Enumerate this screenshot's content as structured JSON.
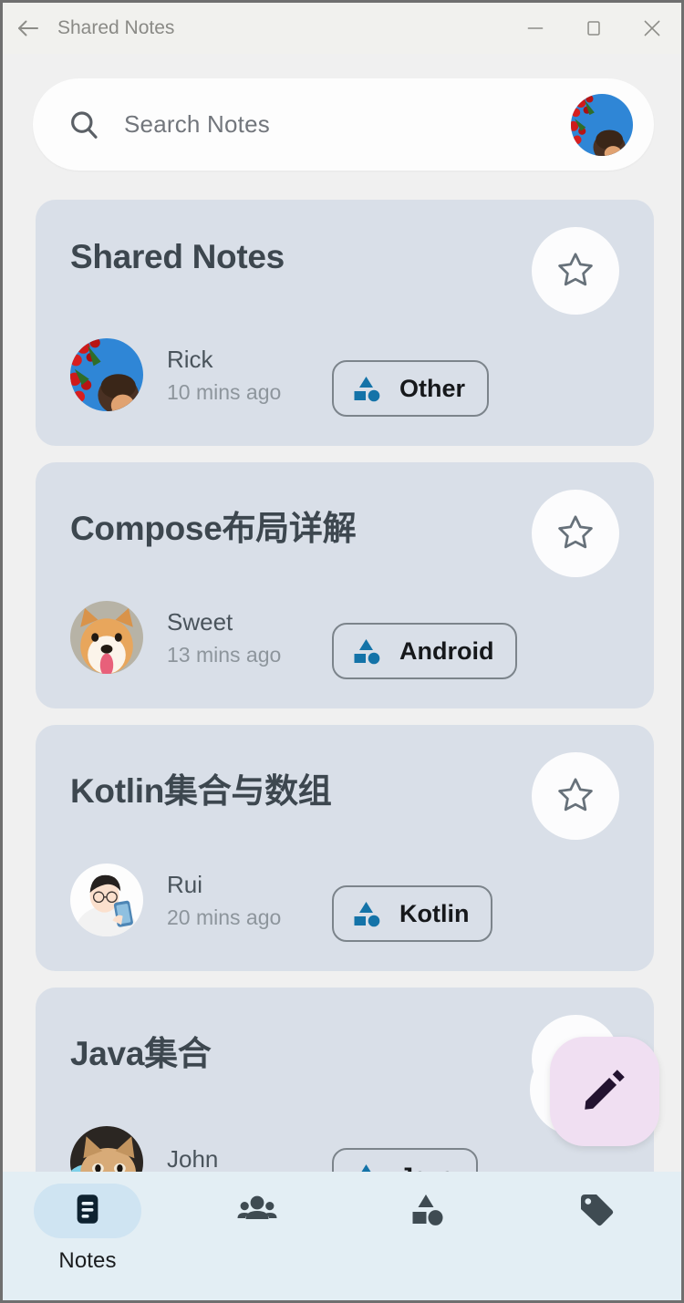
{
  "window": {
    "title": "Shared Notes",
    "back_icon": "arrow-left-icon",
    "minimize_label": "—",
    "maximize_label": "□",
    "close_label": "✕"
  },
  "search": {
    "placeholder": "Search Notes",
    "icon": "search-icon",
    "avatar_name": "user-avatar"
  },
  "colors": {
    "page_background": "#f0f0f0",
    "titlebar_background": "#f1f1ee",
    "card_background": "#d9dfe8",
    "card_title": "#3d474f",
    "chip_icon_blue": "#1473a8",
    "bottomnav_background": "#e3eef4",
    "nav_active_pill": "#cfe4f2",
    "fab_background": "#f0dff2",
    "fab_icon": "#231330",
    "nav_icon": "#3f4b52"
  },
  "notes": [
    {
      "title": "Shared Notes",
      "author": "Rick",
      "time": "10 mins ago",
      "category": "Other",
      "starred": false,
      "star_icon": "star-outline-icon",
      "category_icon": "shapes-icon",
      "avatar": "avatar-rick"
    },
    {
      "title": "Compose布局详解",
      "author": "Sweet",
      "time": "13 mins ago",
      "category": "Android",
      "starred": false,
      "star_icon": "star-outline-icon",
      "category_icon": "shapes-icon",
      "avatar": "avatar-sweet"
    },
    {
      "title": "Kotlin集合与数组",
      "author": "Rui",
      "time": "20 mins ago",
      "category": "Kotlin",
      "starred": false,
      "star_icon": "star-outline-icon",
      "category_icon": "shapes-icon",
      "avatar": "avatar-rui"
    },
    {
      "title": "Java集合",
      "author": "John",
      "time": "",
      "category": "Java",
      "starred": false,
      "star_icon": "star-outline-icon",
      "category_icon": "shapes-icon",
      "avatar": "avatar-john"
    }
  ],
  "fab": {
    "icon": "edit-pencil-icon",
    "label": "Create note"
  },
  "bottom_nav": {
    "items": [
      {
        "label": "Notes",
        "icon": "notes-icon",
        "active": true
      },
      {
        "label": "",
        "icon": "people-icon",
        "active": false
      },
      {
        "label": "",
        "icon": "shapes-icon",
        "active": false
      },
      {
        "label": "",
        "icon": "tag-icon",
        "active": false
      }
    ]
  }
}
